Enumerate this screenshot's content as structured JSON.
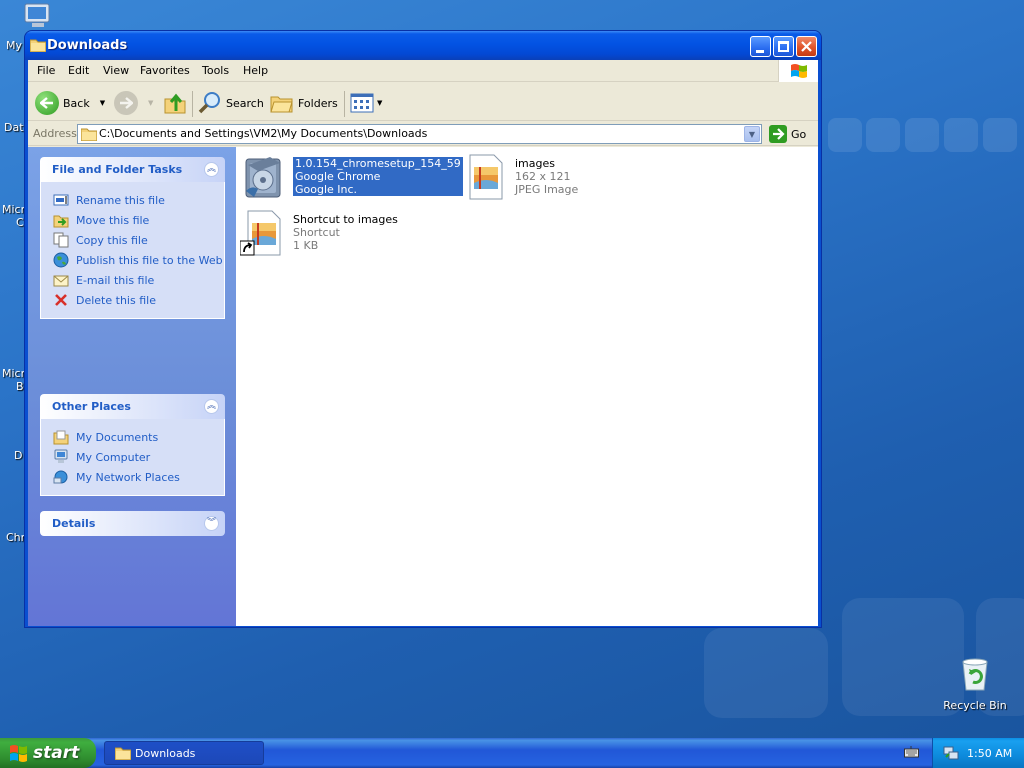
{
  "window": {
    "title": "Downloads"
  },
  "menu": [
    "File",
    "Edit",
    "View",
    "Favorites",
    "Tools",
    "Help"
  ],
  "toolbar": {
    "back_label": "Back",
    "search_label": "Search",
    "folders_label": "Folders"
  },
  "address": {
    "label": "Address",
    "path": "C:\\Documents and Settings\\VM2\\My Documents\\Downloads",
    "go_label": "Go"
  },
  "tasks_panel": {
    "title": "File and Folder Tasks",
    "items": [
      {
        "label": "Rename this file",
        "icon": "rename-icon"
      },
      {
        "label": "Move this file",
        "icon": "move-icon"
      },
      {
        "label": "Copy this file",
        "icon": "copy-icon"
      },
      {
        "label": "Publish this file to the Web",
        "icon": "globe-icon"
      },
      {
        "label": "E-mail this file",
        "icon": "email-icon"
      },
      {
        "label": "Delete this file",
        "icon": "delete-icon"
      }
    ]
  },
  "places_panel": {
    "title": "Other Places",
    "items": [
      {
        "label": "My Documents",
        "icon": "my-documents-icon"
      },
      {
        "label": "My Computer",
        "icon": "my-computer-icon"
      },
      {
        "label": "My Network Places",
        "icon": "network-places-icon"
      }
    ]
  },
  "details_panel": {
    "title": "Details"
  },
  "files": [
    {
      "name": "1.0.154_chromesetup_154_59",
      "line2": "Google Chrome",
      "line3": "Google Inc.",
      "icon": "installer-icon",
      "selected": true
    },
    {
      "name": "images",
      "line2": "162 x 121",
      "line3": "JPEG Image",
      "icon": "jpeg-icon",
      "selected": false
    },
    {
      "name": "Shortcut to images",
      "line2": "Shortcut",
      "line3": "1 KB",
      "icon": "shortcut-jpeg-icon",
      "selected": false
    }
  ],
  "desktop": {
    "cut_labels": [
      "My",
      "Dat",
      "Micr",
      "C",
      "Micr",
      "B",
      "D",
      "Chr"
    ],
    "recycle_bin_label": "Recycle Bin"
  },
  "taskbar": {
    "start_label": "start",
    "task_button_label": "Downloads",
    "clock": "1:50 AM"
  },
  "colors": {
    "title_blue": "#0353e3",
    "task_link": "#215dc6",
    "selection": "#316ac5",
    "start_green": "#3fae3f"
  }
}
